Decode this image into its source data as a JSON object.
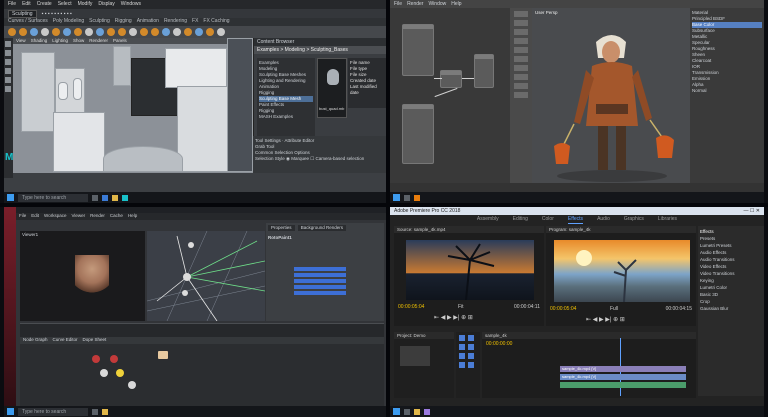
{
  "maya": {
    "menu": [
      "File",
      "Edit",
      "Create",
      "Select",
      "Modify",
      "Display",
      "Windows"
    ],
    "mode": "Sculpting",
    "shelf_tabs": [
      "Curves / Surfaces",
      "Poly Modeling",
      "Sculpting",
      "Rigging",
      "Animation",
      "Rendering",
      "FX",
      "FX Caching",
      "Custom",
      "Arnold",
      "Bifrost",
      "MASH",
      "Motion Graphics",
      "XGen",
      "TURTLE"
    ],
    "viewport_menu": [
      "View",
      "Shading",
      "Lighting",
      "Show",
      "Renderer",
      "Panels"
    ],
    "content_browser_title": "Content Browser",
    "breadcrumb": "Examples > Modeling > Sculpting_Bases",
    "tree": [
      "Examples",
      "Modeling",
      "Sculpting Base Meshes",
      "Lighting and Rendering",
      "Animation",
      "Rigging",
      "Sculpting Base Mesh",
      "Paint Effects",
      "Rigging",
      "MASH Examples"
    ],
    "tree_selected": "Sculpting Base Mesh",
    "thumb_label": "bust_quad.mb",
    "context_menu": [
      "File name",
      "File type",
      "File size",
      "Created date",
      "Last modified date"
    ],
    "import_label": "Do import a file at",
    "preview_label": "No preview available",
    "btn_read": "Read Text",
    "btn_next": "Next Step",
    "tool_settings": "Tool Settings",
    "attr_editor": "Attribute Editor",
    "sculpt_tool": "Grab Tool",
    "common_sel": "Common Selection Options",
    "selection_mode": "Selection Style",
    "marquee": "Marquee",
    "camera_based": "Camera-based selection",
    "taskbar_search": "Type here to search"
  },
  "blender": {
    "header": [
      "File",
      "Render",
      "Window",
      "Help"
    ],
    "viewport_label": "User Persp",
    "props": [
      "Material",
      "Principled BSDF",
      "Base Color",
      "Subsurface",
      "Metallic",
      "Specular",
      "Roughness",
      "Sheen",
      "Clearcoat",
      "IOR",
      "Transmission",
      "Emission",
      "Alpha",
      "Normal"
    ],
    "props_selected": "Base Color"
  },
  "nuke": {
    "menu": [
      "File",
      "Edit",
      "Workspace",
      "Viewer",
      "Render",
      "Cache",
      "Help"
    ],
    "panel_tabs": [
      "Properties",
      "Background Renders"
    ],
    "panel_title": "RotoPaint1",
    "viewer_label": "Viewer1",
    "dag_tabs": [
      "Node Graph",
      "Curve Editor",
      "Dope Sheet"
    ],
    "taskbar_search": "Type here to search"
  },
  "premiere": {
    "window_title": "Adobe Premiere Pro CC 2018",
    "workspaces": [
      "Assembly",
      "Editing",
      "Color",
      "Effects",
      "Audio",
      "Graphics",
      "Libraries"
    ],
    "active_workspace": "Effects",
    "source_title": "Source: sample_4k.mp4",
    "program_title": "Program: sample_4k",
    "src_tc_in": "00:00:05:04",
    "src_tc_out": "00:00:04:11",
    "src_fit": "Fit",
    "prog_tc_in": "00:00:05:04",
    "prog_tc_out": "00:00:04:15",
    "prog_fit": "Full",
    "effects_title": "Effects",
    "effects": [
      "Presets",
      "Lumetri Presets",
      "Audio Effects",
      "Audio Transitions",
      "Video Effects",
      "Video Transitions",
      "Keying",
      "Lumetri Color",
      "Basic 3D",
      "Crop",
      "Gaussian Blur"
    ],
    "project_title": "Project: Demo",
    "sequence_title": "sample_4k",
    "sequence_tc": "00:00:00:00",
    "clip1": "sample_4k.mp4 [V]",
    "clip2": "sample_4k.mp4 [V]"
  }
}
